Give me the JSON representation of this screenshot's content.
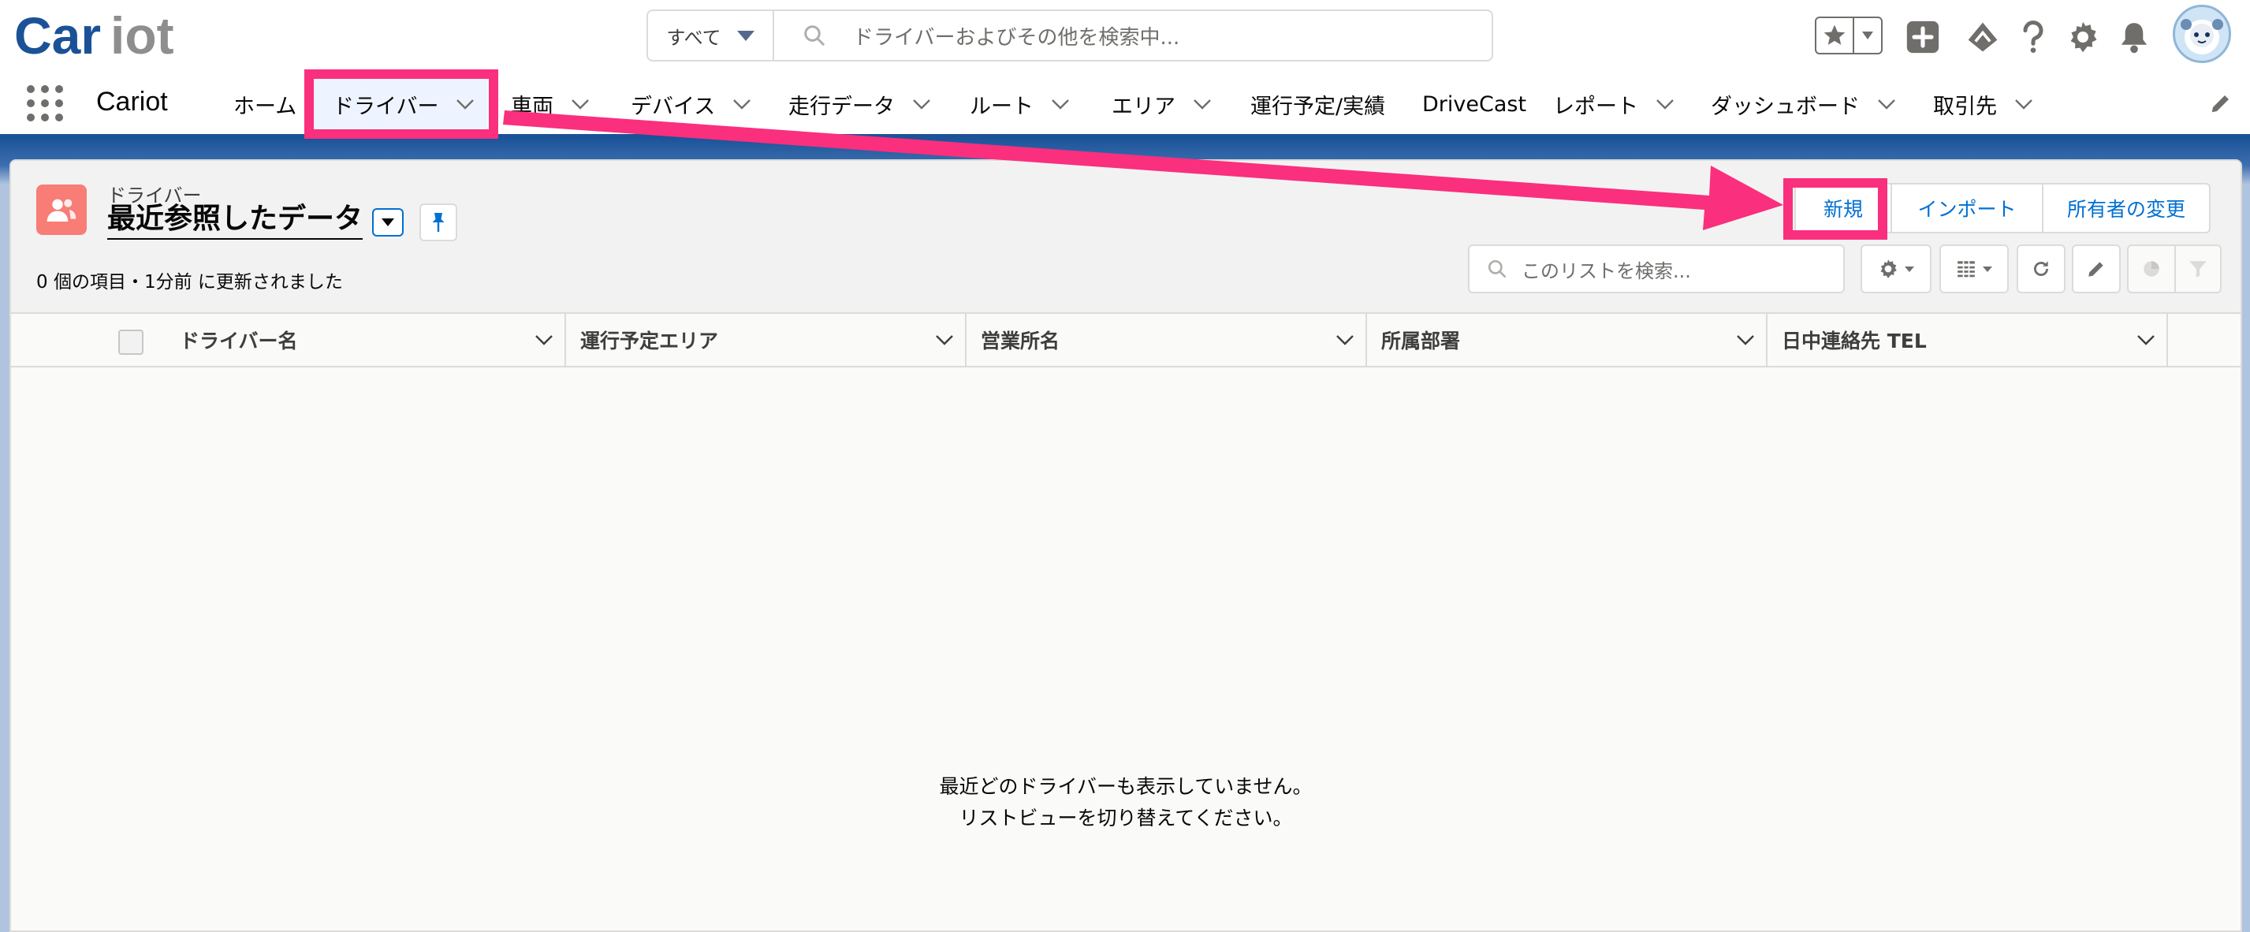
{
  "brand": {
    "logo_text": "Cariot",
    "app_name": "Cariot"
  },
  "global_search": {
    "scope": "すべて",
    "placeholder": "ドライバーおよびその他を検索中..."
  },
  "nav": {
    "items": [
      {
        "label": "ホーム",
        "has_menu": false
      },
      {
        "label": "ドライバー",
        "has_menu": true,
        "active": true
      },
      {
        "label": "車両",
        "has_menu": true
      },
      {
        "label": "デバイス",
        "has_menu": true
      },
      {
        "label": "走行データ",
        "has_menu": true
      },
      {
        "label": "ルート",
        "has_menu": true
      },
      {
        "label": "エリア",
        "has_menu": true
      },
      {
        "label": "運行予定/実績",
        "has_menu": false
      },
      {
        "label": "DriveCast",
        "has_menu": false
      },
      {
        "label": "レポート",
        "has_menu": true
      },
      {
        "label": "ダッシュボード",
        "has_menu": true
      },
      {
        "label": "取引先",
        "has_menu": true
      }
    ]
  },
  "list_view": {
    "object_label": "ドライバー",
    "title": "最近参照したデータ",
    "status": "0 個の項目・1分前 に更新されました",
    "actions": {
      "new": "新規",
      "import": "インポート",
      "change_owner": "所有者の変更"
    },
    "search_placeholder": "このリストを検索...",
    "columns": [
      "ドライバー名",
      "運行予定エリア",
      "営業所名",
      "所属部署",
      "日中連絡先 TEL"
    ],
    "empty_line1": "最近どのドライバーも表示していません。",
    "empty_line2": "リストビューを切り替えてください。"
  },
  "colors": {
    "brand_blue": "#1b5297",
    "link_blue": "#0070d2",
    "highlight_pink": "#fa2f7e",
    "object_icon": "#f87d76"
  },
  "icons": [
    "search-icon",
    "favorites-star-icon",
    "add-icon",
    "trailhead-icon",
    "help-icon",
    "setup-gear-icon",
    "notification-bell-icon",
    "app-launcher-icon",
    "pin-icon",
    "settings-gear-icon",
    "table-view-icon",
    "refresh-icon",
    "edit-pencil-icon",
    "chart-icon",
    "filter-icon"
  ]
}
